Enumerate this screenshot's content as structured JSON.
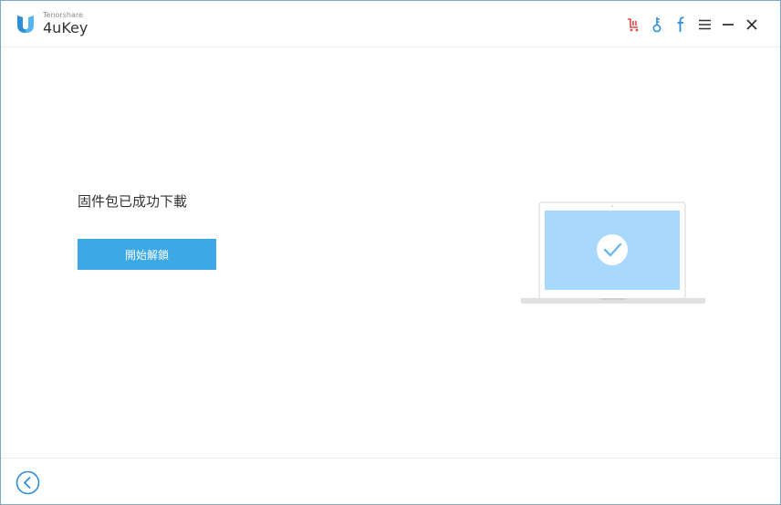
{
  "app": {
    "company": "Tenorshare",
    "product": "4uKey"
  },
  "titlebar": {
    "icons": [
      "cart-icon",
      "key-icon",
      "facebook-icon",
      "menu-icon",
      "minimize-icon",
      "close-icon"
    ],
    "cart_color": "#e24a4a",
    "accent_color": "#2c8fd6"
  },
  "main": {
    "status_text": "固件包已成功下載",
    "action_label": "開始解鎖"
  },
  "colors": {
    "button": "#3aa9e6",
    "screen": "#a8d8fb",
    "border": "#7ea6c9"
  }
}
